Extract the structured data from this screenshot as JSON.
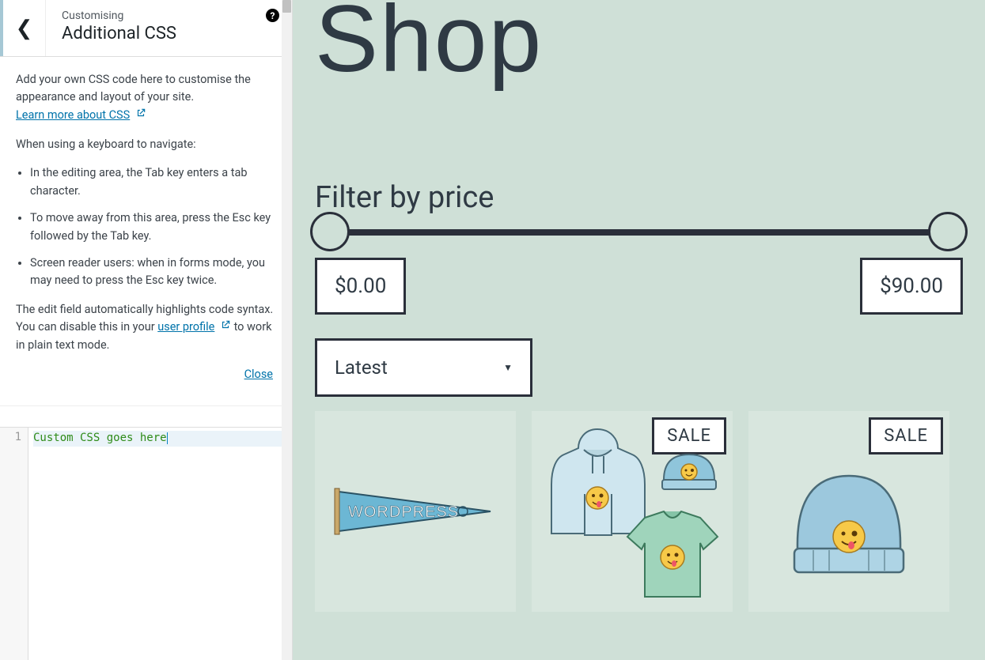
{
  "sidebar": {
    "subtitle": "Customising",
    "title": "Additional CSS",
    "help_glyph": "?",
    "intro": "Add your own CSS code here to customise the appearance and layout of your site.",
    "learn_link": "Learn more about CSS",
    "keyboard_intro": "When using a keyboard to navigate:",
    "tips": [
      "In the editing area, the Tab key enters a tab character.",
      "To move away from this area, press the Esc key followed by the Tab key.",
      "Screen reader users: when in forms mode, you may need to press the Esc key twice."
    ],
    "syntax1": "The edit field automatically highlights code syntax. You can disable this in your ",
    "user_profile": "user profile",
    "syntax2": " to work in plain text mode.",
    "close_label": "Close"
  },
  "editor": {
    "line_no": "1",
    "content": "Custom CSS goes here"
  },
  "preview": {
    "page_title": "Shop",
    "filter_title": "Filter by price",
    "price_min": "$0.00",
    "price_max": "$90.00",
    "sort_selected": "Latest",
    "sale_label": "SALE",
    "pennant_text": "WORDPRESS"
  }
}
